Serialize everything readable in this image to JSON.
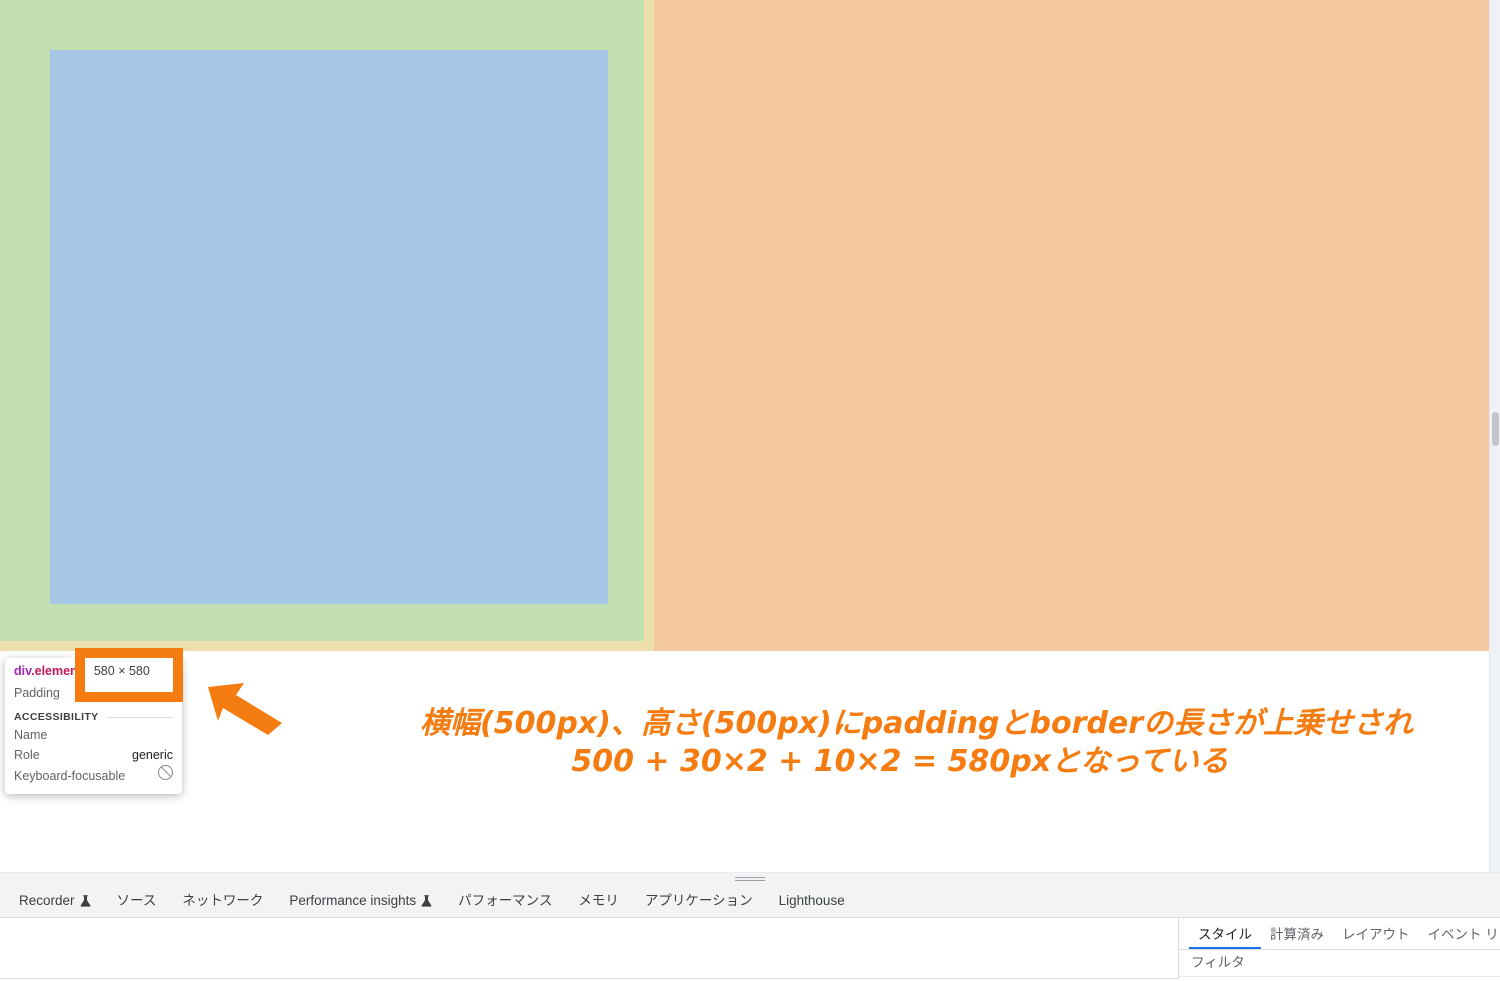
{
  "viewport": {
    "box_model": {
      "margin_color": "#f5c9a0",
      "border_color": "#eddfab",
      "padding_color": "#c2dfb2",
      "content_color": "#a7c7e7"
    },
    "scrollbar": {
      "name": "page-vertical-scrollbar"
    }
  },
  "tooltip": {
    "tag_element": "div",
    "tag_class": ".element",
    "dimensions": "580 × 580",
    "padding_label": "Padding",
    "padding_value": "",
    "accessibility_section": "ACCESSIBILITY",
    "rows": [
      {
        "label": "Name",
        "value": ""
      },
      {
        "label": "Role",
        "value": "generic"
      }
    ],
    "keyboard_focusable_label": "Keyboard-focusable",
    "keyboard_focusable_value": "not-focusable"
  },
  "annotation": {
    "color": "#f57c11",
    "line1": "横幅(500px)、高さ(500px)にpaddingとborderの長さが上乗せされ",
    "line2": "500 + 30×2 + 10×2 = 580pxとなっている",
    "arrow_name": "pointer-arrow",
    "highlight_name": "dimension-highlight-box"
  },
  "devtools": {
    "tabs": [
      {
        "label": "Recorder",
        "experimental": true
      },
      {
        "label": "ソース",
        "experimental": false
      },
      {
        "label": "ネットワーク",
        "experimental": false
      },
      {
        "label": "Performance insights",
        "experimental": true
      },
      {
        "label": "パフォーマンス",
        "experimental": false
      },
      {
        "label": "メモリ",
        "experimental": false
      },
      {
        "label": "アプリケーション",
        "experimental": false
      },
      {
        "label": "Lighthouse",
        "experimental": false
      }
    ],
    "styles_panel": {
      "tabs": [
        {
          "label": "スタイル",
          "active": true
        },
        {
          "label": "計算済み",
          "active": false
        },
        {
          "label": "レイアウト",
          "active": false
        },
        {
          "label": "イベント リス",
          "active": false
        }
      ],
      "filter_placeholder": "フィルタ"
    },
    "splitter_name": "drawer-splitter"
  }
}
